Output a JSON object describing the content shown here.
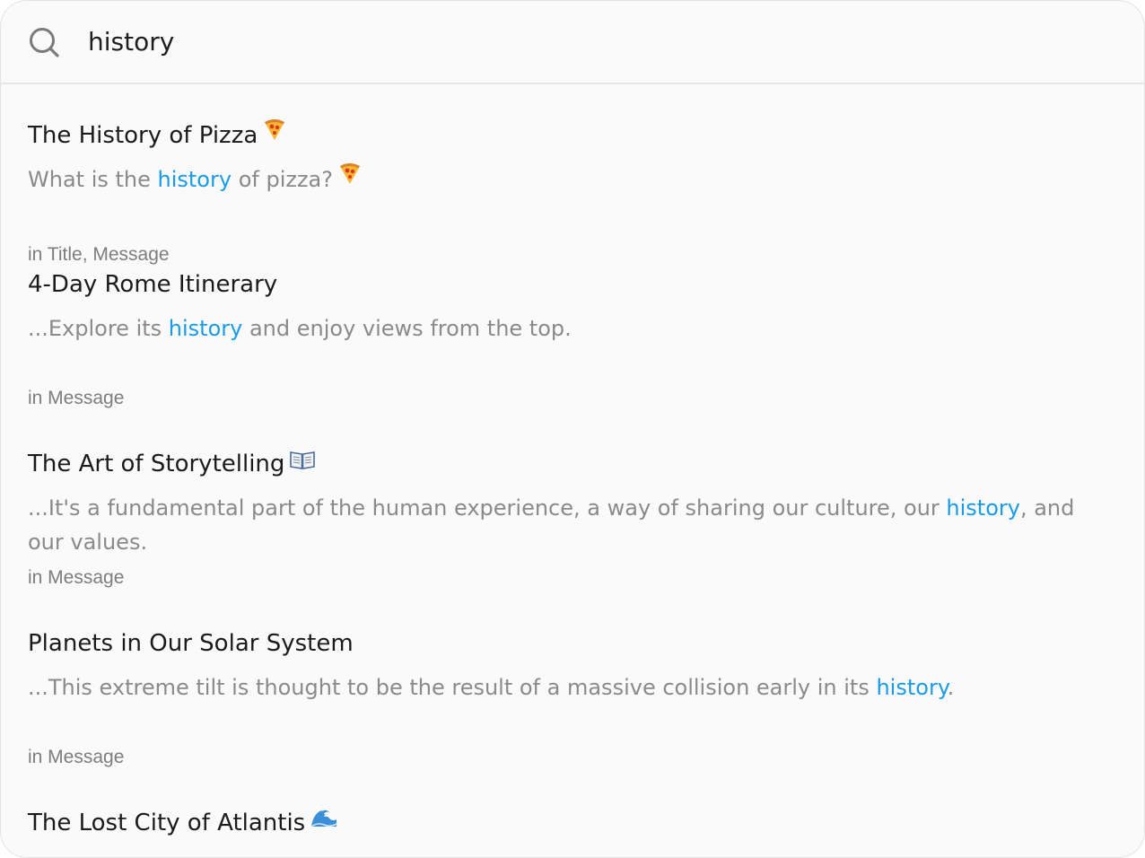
{
  "search": {
    "query": "history",
    "icon": "search-icon"
  },
  "results": [
    {
      "title": "The History of Pizza",
      "title_icon": "pizza-icon",
      "snippet_before": "What is the ",
      "snippet_match": "history",
      "snippet_after": " of pizza?",
      "snippet_icon": "pizza-icon",
      "where": "in Title, Message"
    },
    {
      "title": "4-Day Rome Itinerary",
      "snippet_before": "...Explore its ",
      "snippet_match": "history",
      "snippet_after": " and enjoy views from the top.",
      "where": "in Message"
    },
    {
      "title": "The Art of Storytelling",
      "title_icon": "open-book-icon",
      "snippet_before": "...It's a fundamental part of the human experience, a way of sharing our culture, our ",
      "snippet_match": "history",
      "snippet_after": ", and our values.",
      "where": "in Message"
    },
    {
      "title": "Planets in Our Solar System",
      "snippet_before": "...This extreme tilt is thought to be the result of a massive collision early in its ",
      "snippet_match": "history",
      "snippet_after": ".",
      "where": "in Message"
    },
    {
      "title": "The Lost City of Atlantis",
      "title_icon": "water-wave-icon"
    }
  ],
  "colors": {
    "highlight": "#1a9be8",
    "title": "#1b1b1b",
    "snippet": "#8a8a8a",
    "meta": "#7d7d7d",
    "background": "#fafafa"
  }
}
